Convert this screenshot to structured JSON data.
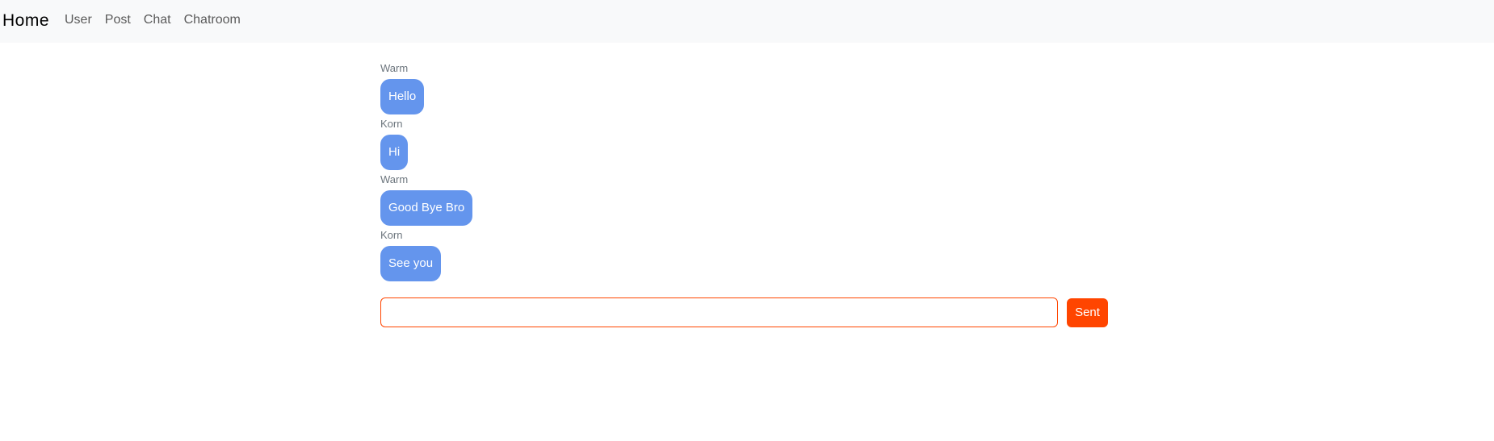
{
  "navbar": {
    "brand": "Home",
    "links": [
      {
        "label": "User"
      },
      {
        "label": "Post"
      },
      {
        "label": "Chat"
      },
      {
        "label": "Chatroom"
      }
    ]
  },
  "messages": [
    {
      "sender": "Warm",
      "text": "Hello"
    },
    {
      "sender": "Korn",
      "text": "Hi"
    },
    {
      "sender": "Warm",
      "text": "Good Bye Bro"
    },
    {
      "sender": "Korn",
      "text": "See you"
    }
  ],
  "composer": {
    "input_value": "",
    "placeholder": "",
    "send_label": "Sent"
  },
  "colors": {
    "bubble": "#6495ed",
    "accent": "#ff4500",
    "navbar_bg": "#f8f9fa"
  }
}
